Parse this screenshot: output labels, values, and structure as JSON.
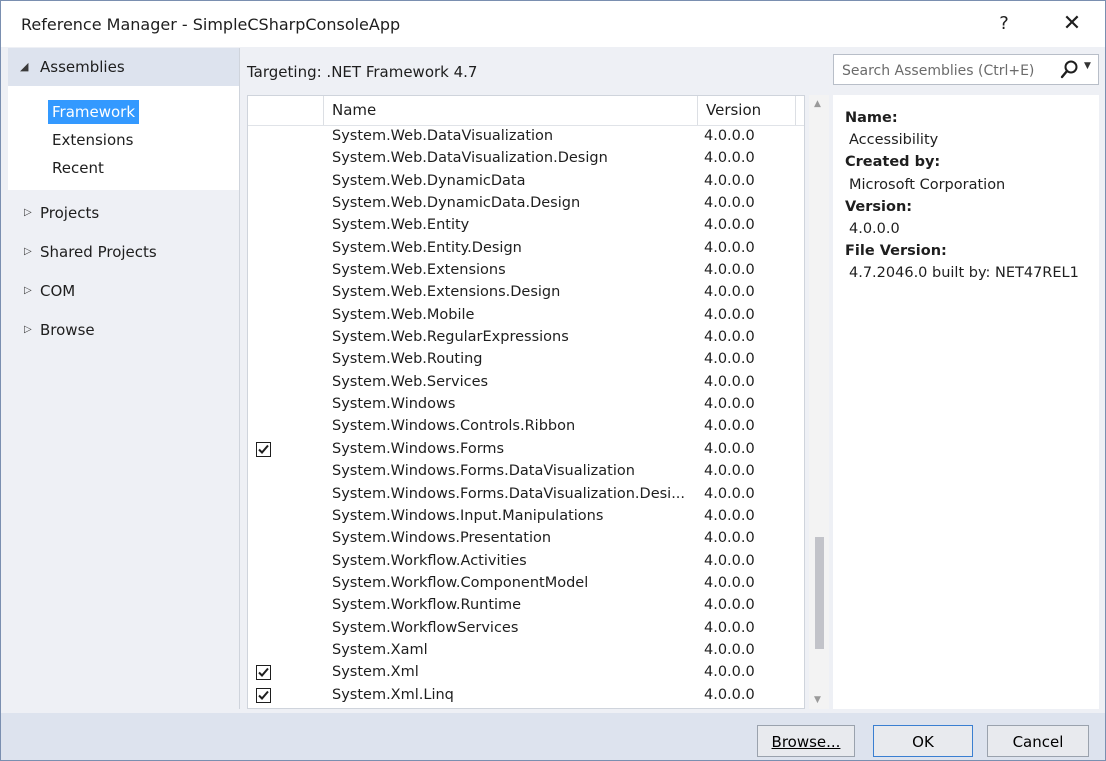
{
  "window": {
    "title": "Reference Manager - SimpleCSharpConsoleApp",
    "help_label": "?",
    "close_label": "✕"
  },
  "nav": {
    "header": "Assemblies",
    "sub_items": [
      "Framework",
      "Extensions",
      "Recent"
    ],
    "selected_sub": "Framework",
    "items": [
      "Projects",
      "Shared Projects",
      "COM",
      "Browse"
    ]
  },
  "targeting": "Targeting: .NET Framework 4.7",
  "search": {
    "placeholder": "Search Assemblies (Ctrl+E)"
  },
  "list": {
    "headers": {
      "name": "Name",
      "version": "Version"
    },
    "rows": [
      {
        "name": "System.Web.DataVisualization",
        "version": "4.0.0.0",
        "checked": false
      },
      {
        "name": "System.Web.DataVisualization.Design",
        "version": "4.0.0.0",
        "checked": false
      },
      {
        "name": "System.Web.DynamicData",
        "version": "4.0.0.0",
        "checked": false
      },
      {
        "name": "System.Web.DynamicData.Design",
        "version": "4.0.0.0",
        "checked": false
      },
      {
        "name": "System.Web.Entity",
        "version": "4.0.0.0",
        "checked": false
      },
      {
        "name": "System.Web.Entity.Design",
        "version": "4.0.0.0",
        "checked": false
      },
      {
        "name": "System.Web.Extensions",
        "version": "4.0.0.0",
        "checked": false
      },
      {
        "name": "System.Web.Extensions.Design",
        "version": "4.0.0.0",
        "checked": false
      },
      {
        "name": "System.Web.Mobile",
        "version": "4.0.0.0",
        "checked": false
      },
      {
        "name": "System.Web.RegularExpressions",
        "version": "4.0.0.0",
        "checked": false
      },
      {
        "name": "System.Web.Routing",
        "version": "4.0.0.0",
        "checked": false
      },
      {
        "name": "System.Web.Services",
        "version": "4.0.0.0",
        "checked": false
      },
      {
        "name": "System.Windows",
        "version": "4.0.0.0",
        "checked": false
      },
      {
        "name": "System.Windows.Controls.Ribbon",
        "version": "4.0.0.0",
        "checked": false
      },
      {
        "name": "System.Windows.Forms",
        "version": "4.0.0.0",
        "checked": true
      },
      {
        "name": "System.Windows.Forms.DataVisualization",
        "version": "4.0.0.0",
        "checked": false
      },
      {
        "name": "System.Windows.Forms.DataVisualization.Desi...",
        "version": "4.0.0.0",
        "checked": false
      },
      {
        "name": "System.Windows.Input.Manipulations",
        "version": "4.0.0.0",
        "checked": false
      },
      {
        "name": "System.Windows.Presentation",
        "version": "4.0.0.0",
        "checked": false
      },
      {
        "name": "System.Workflow.Activities",
        "version": "4.0.0.0",
        "checked": false
      },
      {
        "name": "System.Workflow.ComponentModel",
        "version": "4.0.0.0",
        "checked": false
      },
      {
        "name": "System.Workflow.Runtime",
        "version": "4.0.0.0",
        "checked": false
      },
      {
        "name": "System.WorkflowServices",
        "version": "4.0.0.0",
        "checked": false
      },
      {
        "name": "System.Xaml",
        "version": "4.0.0.0",
        "checked": false
      },
      {
        "name": "System.Xml",
        "version": "4.0.0.0",
        "checked": true
      },
      {
        "name": "System.Xml.Linq",
        "version": "4.0.0.0",
        "checked": true
      }
    ]
  },
  "details": {
    "name_label": "Name:",
    "name_value": "Accessibility",
    "created_label": "Created by:",
    "created_value": "Microsoft Corporation",
    "version_label": "Version:",
    "version_value": "4.0.0.0",
    "file_version_label": "File Version:",
    "file_version_value": "4.7.2046.0 built by: NET47REL1"
  },
  "buttons": {
    "browse": "Browse...",
    "ok": "OK",
    "cancel": "Cancel"
  },
  "colors": {
    "selection": "#3399ff",
    "footer": "#dde3ee",
    "accent_border": "#3a7fd1"
  }
}
